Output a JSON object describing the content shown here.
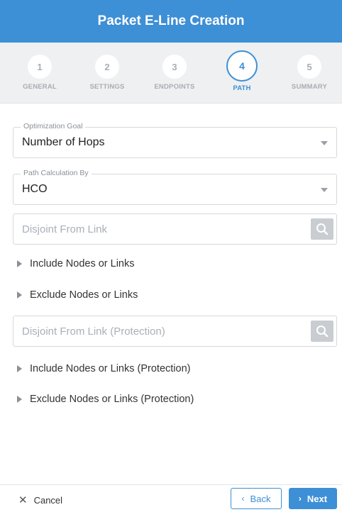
{
  "header": {
    "title": "Packet E-Line Creation"
  },
  "steps": [
    {
      "num": "1",
      "label": "GENERAL"
    },
    {
      "num": "2",
      "label": "SETTINGS"
    },
    {
      "num": "3",
      "label": "ENDPOINTS"
    },
    {
      "num": "4",
      "label": "PATH"
    },
    {
      "num": "5",
      "label": "SUMMARY"
    }
  ],
  "active_step": "4",
  "form": {
    "optimization_goal": {
      "label": "Optimization Goal",
      "value": "Number of Hops"
    },
    "path_calculation": {
      "label": "Path Calculation By",
      "value": "HCO"
    },
    "disjoint_from_link": {
      "placeholder": "Disjoint From Link"
    },
    "include_nodes": "Include Nodes or Links",
    "exclude_nodes": "Exclude Nodes or Links",
    "disjoint_protection": {
      "placeholder": "Disjoint From Link (Protection)"
    },
    "include_protection": "Include Nodes or Links (Protection)",
    "exclude_protection": "Exclude Nodes or Links (Protection)"
  },
  "footer": {
    "cancel": "Cancel",
    "back": "Back",
    "next": "Next"
  },
  "colors": {
    "accent": "#3d8fd6",
    "stepper_bg": "#eef0f2",
    "search_button": "#c9cdd1"
  }
}
